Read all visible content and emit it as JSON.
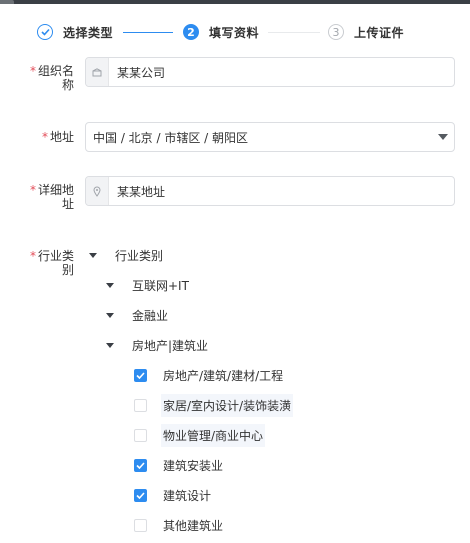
{
  "steps": [
    {
      "label": "选择类型",
      "number": "",
      "state": "done"
    },
    {
      "label": "填写资料",
      "number": "2",
      "state": "active"
    },
    {
      "label": "上传证件",
      "number": "3",
      "state": "pending"
    }
  ],
  "form": {
    "required_mark": "*",
    "org_name": {
      "label_line1": "组织名",
      "label_line2": "称",
      "value": "某某公司",
      "icon": "building-icon"
    },
    "address": {
      "label": "地址",
      "value": "中国 / 北京 / 市辖区 / 朝阳区"
    },
    "detail_address": {
      "label_line1": "详细地",
      "label_line2": "址",
      "value": "某某地址",
      "icon": "location-pin-icon"
    },
    "industry": {
      "label_line1": "行业类",
      "label_line2": "别"
    }
  },
  "tree": {
    "root": "行业类别",
    "children": [
      "互联网+IT",
      "金融业",
      "房地产|建筑业"
    ],
    "leaves": [
      {
        "label": "房地产/建筑/建材/工程",
        "checked": true
      },
      {
        "label": "家居/室内设计/装饰装潢",
        "checked": false
      },
      {
        "label": "物业管理/商业中心",
        "checked": false
      },
      {
        "label": "建筑安装业",
        "checked": true
      },
      {
        "label": "建筑设计",
        "checked": true
      },
      {
        "label": "其他建筑业",
        "checked": false
      }
    ]
  },
  "colors": {
    "primary": "#2d8cf0",
    "required": "#e34d59",
    "border": "#dcdee2"
  }
}
